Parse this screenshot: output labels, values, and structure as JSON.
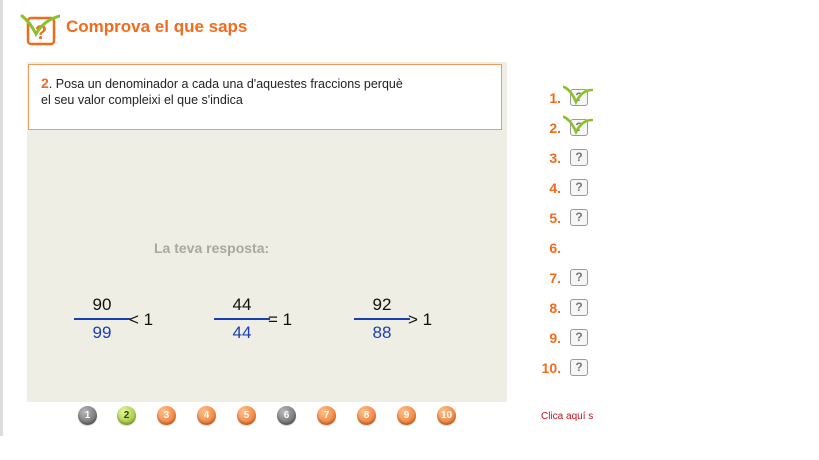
{
  "header": {
    "title": "Comprova el que saps"
  },
  "question": {
    "number": "2",
    "text_line1": ". Posa un denominador a cada una d'aquestes fraccions perquè",
    "text_line2": "el seu valor compleixi el que s'indica"
  },
  "answer": {
    "label": "La teva resposta:",
    "fractions": [
      {
        "numerator": "90",
        "denominator": "99",
        "relation": "< 1"
      },
      {
        "numerator": "44",
        "denominator": "44",
        "relation": "= 1"
      },
      {
        "numerator": "92",
        "denominator": "88",
        "relation": "> 1"
      }
    ]
  },
  "pagination": {
    "pages": [
      {
        "label": "1",
        "state": "grey"
      },
      {
        "label": "2",
        "state": "green"
      },
      {
        "label": "3",
        "state": "orange"
      },
      {
        "label": "4",
        "state": "orange"
      },
      {
        "label": "5",
        "state": "orange"
      },
      {
        "label": "6",
        "state": "grey"
      },
      {
        "label": "7",
        "state": "orange"
      },
      {
        "label": "8",
        "state": "orange"
      },
      {
        "label": "9",
        "state": "orange"
      },
      {
        "label": "10",
        "state": "orange"
      }
    ]
  },
  "progress_list": {
    "items": [
      {
        "label": "1.",
        "icon": "?",
        "status": "answered"
      },
      {
        "label": "2.",
        "icon": "?",
        "status": "answered"
      },
      {
        "label": "3.",
        "icon": "?",
        "status": "pending"
      },
      {
        "label": "4.",
        "icon": "?",
        "status": "pending"
      },
      {
        "label": "5.",
        "icon": "?",
        "status": "pending"
      },
      {
        "label": "6.",
        "icon": "",
        "status": "none"
      },
      {
        "label": "7.",
        "icon": "?",
        "status": "pending"
      },
      {
        "label": "8.",
        "icon": "?",
        "status": "pending"
      },
      {
        "label": "9.",
        "icon": "?",
        "status": "pending"
      },
      {
        "label": "10.",
        "icon": "?",
        "status": "pending"
      }
    ]
  },
  "click_here_label": "Clica aquí s",
  "colors": {
    "accent": "#f26b1d",
    "panel": "#eeeee4",
    "fraction_blue": "#1a3fb5",
    "check_green": "#8bc12a",
    "link_red": "#c4121a"
  }
}
